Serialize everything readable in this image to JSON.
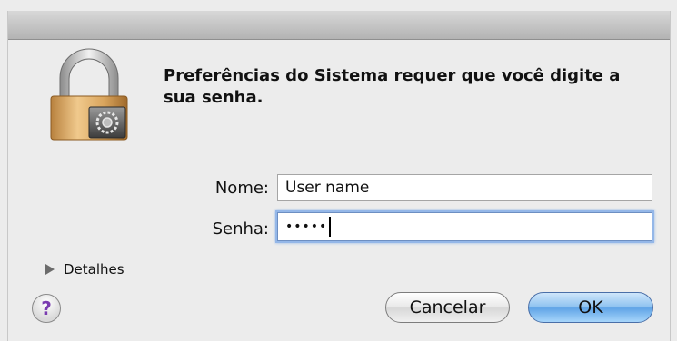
{
  "dialog": {
    "message": "Preferências do Sistema requer que você digite a sua senha."
  },
  "form": {
    "name_label": "Nome:",
    "name_value": "User name",
    "password_label": "Senha:",
    "password_masked": "•••••"
  },
  "details": {
    "label": "Detalhes"
  },
  "buttons": {
    "help": "?",
    "cancel": "Cancelar",
    "ok": "OK"
  },
  "icons": {
    "lock": "lock-icon",
    "disclosure": "disclosure-triangle-icon",
    "help": "help-icon"
  },
  "colors": {
    "background": "#ececec",
    "focus_ring": "#94b7e8",
    "default_button": "#5ea3e6",
    "lock_body": "#d9a45c"
  }
}
